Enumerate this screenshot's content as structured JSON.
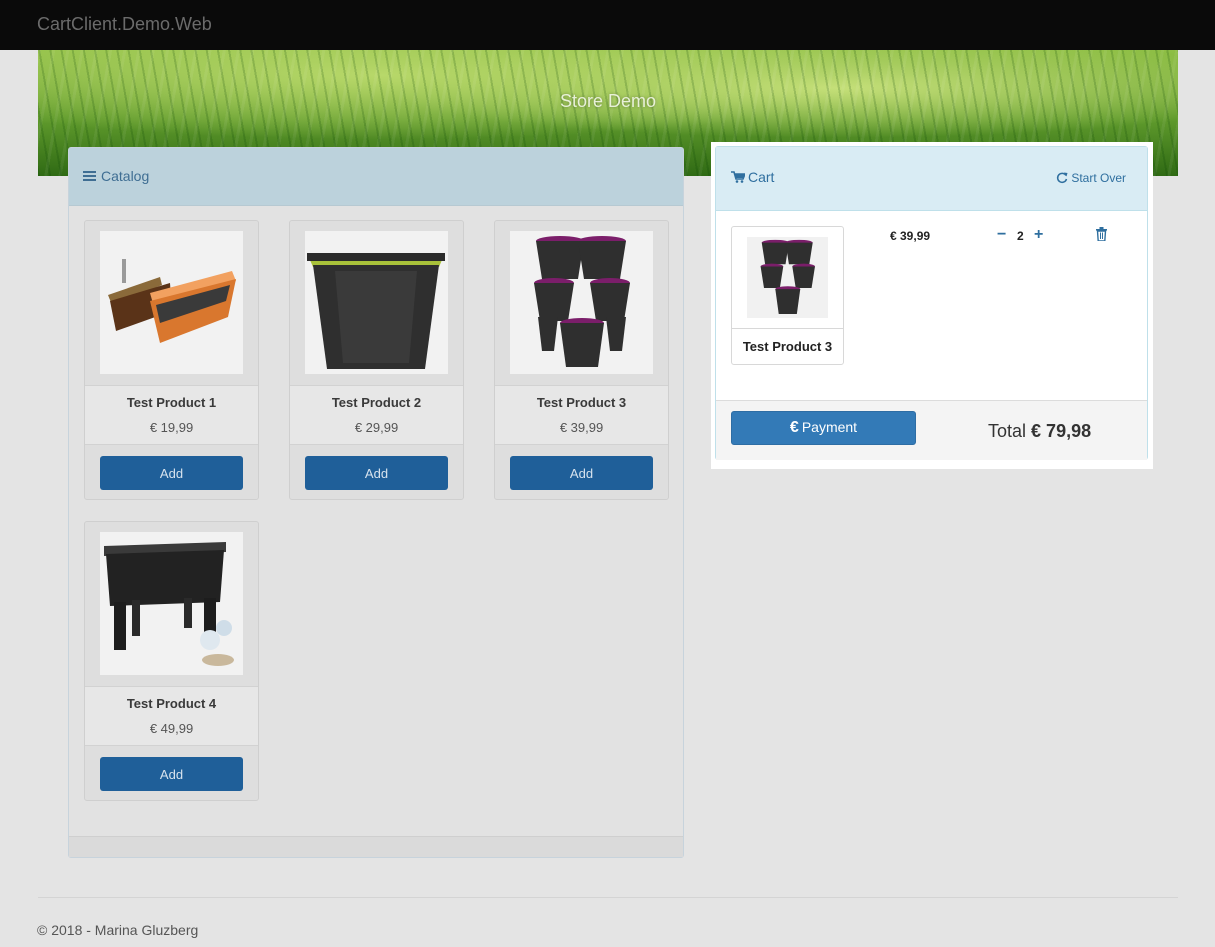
{
  "navbar": {
    "brand": "CartClient.Demo.Web"
  },
  "banner": {
    "title": "Store Demo"
  },
  "catalog": {
    "title": "Catalog",
    "products": [
      {
        "name": "Test Product 1",
        "price": "€ 19,99",
        "add_label": "Add",
        "image": "planter-boxes"
      },
      {
        "name": "Test Product 2",
        "price": "€ 29,99",
        "add_label": "Add",
        "image": "square-pot"
      },
      {
        "name": "Test Product 3",
        "price": "€ 39,99",
        "add_label": "Add",
        "image": "stacked-pots"
      },
      {
        "name": "Test Product 4",
        "price": "€ 49,99",
        "add_label": "Add",
        "image": "raised-planter"
      }
    ]
  },
  "cart": {
    "title": "Cart",
    "start_over": "Start Over",
    "items": [
      {
        "name": "Test Product 3",
        "price": "€ 39,99",
        "quantity": "2",
        "image": "stacked-pots"
      }
    ],
    "payment_label": "Payment",
    "total_label": "Total",
    "total_value": "€ 79,98"
  },
  "footer": {
    "text": "© 2018 - Marina Gluzberg"
  },
  "colors": {
    "accent": "#337ab7",
    "button_dark": "#1f5f99",
    "navbar": "#0a0a0a",
    "cart_header": "#d9ecf4"
  }
}
